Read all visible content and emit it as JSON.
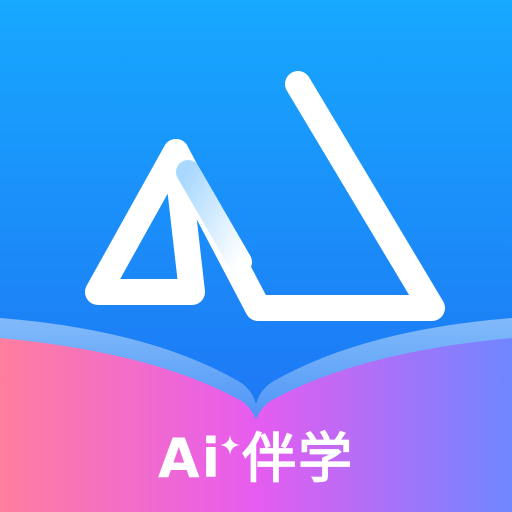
{
  "app_icon": {
    "label_latin": "Ai",
    "label_cjk": "伴学",
    "icons": {
      "logo": "mountain-peaks-icon",
      "book": "open-book-icon",
      "sparkle": "sparkle-star-icon"
    },
    "colors": {
      "background_top": "#17A8FF",
      "background_bottom": "#1F6CF2",
      "book_left": "#FF7E9E",
      "book_middle": "#E65CF0",
      "book_right": "#6F86FF",
      "logo": "#FFFFFF",
      "text": "#FFFFFF"
    }
  }
}
